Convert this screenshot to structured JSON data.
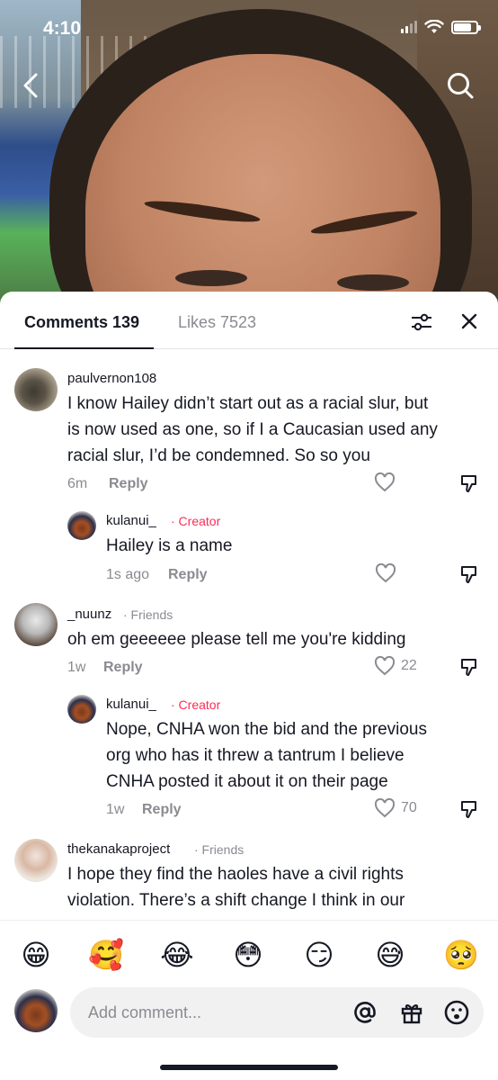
{
  "status_bar": {
    "time": "4:10"
  },
  "tabs": {
    "comments_label": "Comments 139",
    "likes_label": "Likes 7523"
  },
  "comments": [
    {
      "username": "paulvernon108",
      "tag": "",
      "lines": [
        "I know Hailey didn’t start out as a racial slur, but",
        "is now used as one, so if I a Caucasian used any",
        "racial slur, I’d be condemned. So so you"
      ],
      "time": "6m",
      "reply": "Reply",
      "likes": ""
    },
    {
      "username": "kulanui_",
      "tag": "· Creator",
      "lines": [
        "Hailey is a name"
      ],
      "time": "1s ago",
      "reply": "Reply",
      "likes": ""
    },
    {
      "username": "_nuunz",
      "tag": "· Friends",
      "lines": [
        "oh em geeeeee please tell me you're kidding"
      ],
      "time": "1w",
      "reply": "Reply",
      "likes": "22"
    },
    {
      "username": "kulanui_",
      "tag": "· Creator",
      "lines": [
        "Nope, CNHA won the bid and the previous",
        "org who has it threw a tantrum I believe",
        "CNHA posted it about it on their page"
      ],
      "time": "1w",
      "reply": "Reply",
      "likes": "70"
    },
    {
      "username": "thekanakaproject",
      "tag": "· Friends",
      "lines": [
        "I hope they find the haoles have a civil rights",
        "violation. There’s a shift change I think in our"
      ],
      "time": "",
      "reply": "",
      "likes": ""
    }
  ],
  "emojis": [
    "😁",
    "🥰",
    "😂",
    "😳",
    "😏",
    "😅",
    "🥺"
  ],
  "input": {
    "placeholder": "Add comment..."
  },
  "colors": {
    "accent": "#fe2c55",
    "muted": "#8a8b91",
    "text": "#161823"
  },
  "icons": [
    "back-arrow-icon",
    "search-icon",
    "filter-icon",
    "close-icon",
    "heart-icon",
    "dislike-icon",
    "at-icon",
    "gift-icon",
    "emoji-icon"
  ]
}
